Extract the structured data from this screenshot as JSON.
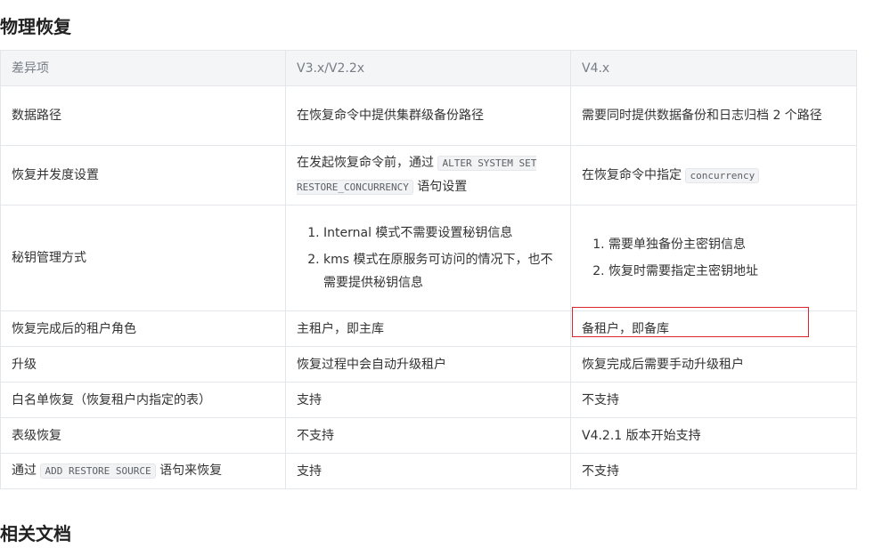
{
  "section_title": "物理恢复",
  "next_section_title": "相关文档",
  "table": {
    "headers": [
      "差异项",
      "V3.x/V2.2x",
      "V4.x"
    ],
    "rows": {
      "data_path": {
        "item": "数据路径",
        "v3": "在恢复命令中提供集群级备份路径",
        "v4": "需要同时提供数据备份和日志归档 2 个路径"
      },
      "concurrency": {
        "item": "恢复并发度设置",
        "v3_pre": "在发起恢复命令前，通过",
        "v3_code": "ALTER SYSTEM SET RESTORE_CONCURRENCY",
        "v3_post": "语句设置",
        "v4_pre": "在恢复命令中指定",
        "v4_code": "concurrency"
      },
      "key_mgmt": {
        "item": "秘钥管理方式",
        "v3_items": [
          "Internal 模式不需要设置秘钥信息",
          "kms 模式在原服务可访问的情况下，也不需要提供秘钥信息"
        ],
        "v4_items": [
          "需要单独备份主密钥信息",
          "恢复时需要指定主密钥地址"
        ]
      },
      "tenant_role": {
        "item": "恢复完成后的租户角色",
        "v3": "主租户，即主库",
        "v4": "备租户，即备库"
      },
      "upgrade": {
        "item": "升级",
        "v3": "恢复过程中会自动升级租户",
        "v4": "恢复完成后需要手动升级租户"
      },
      "whitelist": {
        "item": "白名单恢复（恢复租户内指定的表）",
        "v3": "支持",
        "v4": "不支持"
      },
      "table_level": {
        "item": "表级恢复",
        "v3": "不支持",
        "v4": "V4.2.1 版本开始支持"
      },
      "restore_source": {
        "item_pre": "通过",
        "item_code": "ADD RESTORE SOURCE",
        "item_post": "语句来恢复",
        "v3": "支持",
        "v4": "不支持"
      }
    }
  },
  "highlight_color": "#d9262c"
}
